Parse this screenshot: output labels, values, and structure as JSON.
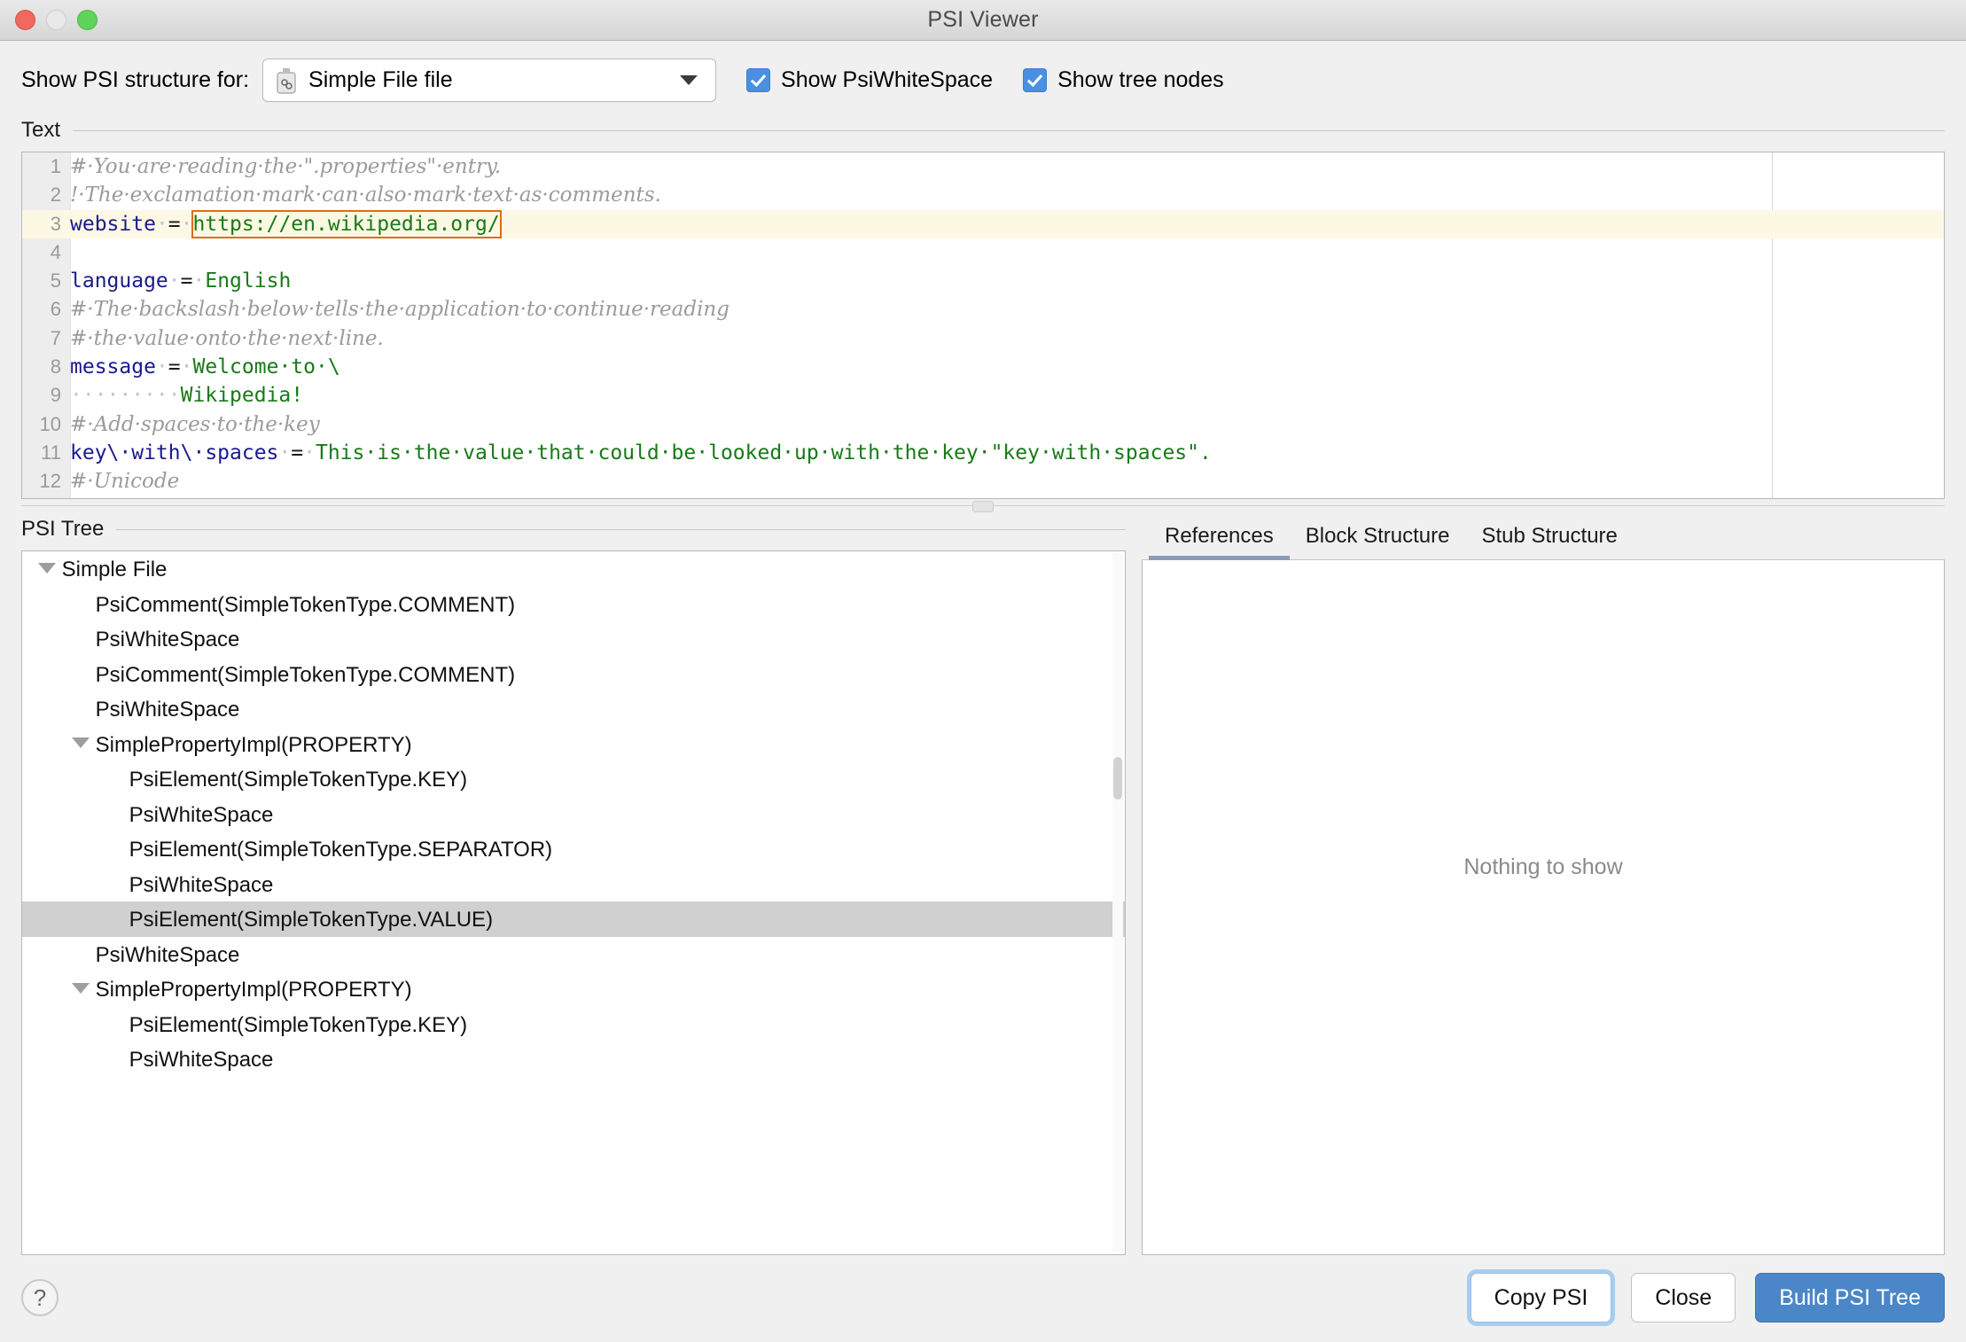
{
  "window": {
    "title": "PSI Viewer",
    "traffic_lights": [
      "close-red",
      "minimize-gray",
      "zoom-green"
    ]
  },
  "toolbar": {
    "label": "Show PSI structure for:",
    "combo": {
      "icon": "properties-file-icon",
      "value": "Simple File file",
      "caret": "chevron-down-icon"
    },
    "checkboxes": [
      {
        "label": "Show PsiWhiteSpace",
        "checked": true
      },
      {
        "label": "Show tree nodes",
        "checked": true
      }
    ]
  },
  "text_group": {
    "title": "Text",
    "lines": [
      {
        "n": "1",
        "highlight": false,
        "tokens": [
          {
            "t": "comment",
            "s": "#·You·are·reading·the·\".properties\"·entry."
          }
        ]
      },
      {
        "n": "2",
        "highlight": false,
        "tokens": [
          {
            "t": "comment",
            "s": "!·The·exclamation·mark·can·also·mark·text·as·comments."
          }
        ]
      },
      {
        "n": "3",
        "highlight": true,
        "tokens": [
          {
            "t": "key",
            "s": "website"
          },
          {
            "t": "ws",
            "s": "·"
          },
          {
            "t": "eq",
            "s": "="
          },
          {
            "t": "ws",
            "s": "·"
          },
          {
            "t": "val-selected",
            "s": "https://en.wikipedia.org/"
          }
        ]
      },
      {
        "n": "4",
        "highlight": false,
        "tokens": []
      },
      {
        "n": "5",
        "highlight": false,
        "tokens": [
          {
            "t": "key",
            "s": "language"
          },
          {
            "t": "ws",
            "s": "·"
          },
          {
            "t": "eq",
            "s": "="
          },
          {
            "t": "ws",
            "s": "·"
          },
          {
            "t": "val",
            "s": "English"
          }
        ]
      },
      {
        "n": "6",
        "highlight": false,
        "tokens": [
          {
            "t": "comment",
            "s": "#·The·backslash·below·tells·the·application·to·continue·reading"
          }
        ]
      },
      {
        "n": "7",
        "highlight": false,
        "tokens": [
          {
            "t": "comment",
            "s": "#·the·value·onto·the·next·line."
          }
        ]
      },
      {
        "n": "8",
        "highlight": false,
        "tokens": [
          {
            "t": "key",
            "s": "message"
          },
          {
            "t": "ws",
            "s": "·"
          },
          {
            "t": "eq",
            "s": "="
          },
          {
            "t": "ws",
            "s": "·"
          },
          {
            "t": "val",
            "s": "Welcome·to·\\"
          }
        ]
      },
      {
        "n": "9",
        "highlight": false,
        "tokens": [
          {
            "t": "ws",
            "s": "·········"
          },
          {
            "t": "val",
            "s": "Wikipedia!"
          }
        ]
      },
      {
        "n": "10",
        "highlight": false,
        "tokens": [
          {
            "t": "comment",
            "s": "#·Add·spaces·to·the·key"
          }
        ]
      },
      {
        "n": "11",
        "highlight": false,
        "tokens": [
          {
            "t": "key",
            "s": "key\\·with\\·spaces"
          },
          {
            "t": "ws",
            "s": "·"
          },
          {
            "t": "eq",
            "s": "="
          },
          {
            "t": "ws",
            "s": "·"
          },
          {
            "t": "val",
            "s": "This·is·the·value·that·could·be·looked·up·with·the·key·\"key·with·spaces\"."
          }
        ]
      },
      {
        "n": "12",
        "highlight": false,
        "tokens": [
          {
            "t": "comment",
            "s": "#·Unicode"
          }
        ]
      }
    ]
  },
  "psi_tree": {
    "title": "PSI Tree",
    "rows": [
      {
        "label": "Simple File",
        "indent": 0,
        "twisty": true,
        "selected": false
      },
      {
        "label": "PsiComment(SimpleTokenType.COMMENT)",
        "indent": 1,
        "twisty": false,
        "selected": false
      },
      {
        "label": "PsiWhiteSpace",
        "indent": 1,
        "twisty": false,
        "selected": false
      },
      {
        "label": "PsiComment(SimpleTokenType.COMMENT)",
        "indent": 1,
        "twisty": false,
        "selected": false
      },
      {
        "label": "PsiWhiteSpace",
        "indent": 1,
        "twisty": false,
        "selected": false
      },
      {
        "label": "SimplePropertyImpl(PROPERTY)",
        "indent": 1,
        "twisty": true,
        "selected": false
      },
      {
        "label": "PsiElement(SimpleTokenType.KEY)",
        "indent": 2,
        "twisty": false,
        "selected": false
      },
      {
        "label": "PsiWhiteSpace",
        "indent": 2,
        "twisty": false,
        "selected": false
      },
      {
        "label": "PsiElement(SimpleTokenType.SEPARATOR)",
        "indent": 2,
        "twisty": false,
        "selected": false
      },
      {
        "label": "PsiWhiteSpace",
        "indent": 2,
        "twisty": false,
        "selected": false
      },
      {
        "label": "PsiElement(SimpleTokenType.VALUE)",
        "indent": 2,
        "twisty": false,
        "selected": true
      },
      {
        "label": "PsiWhiteSpace",
        "indent": 1,
        "twisty": false,
        "selected": false
      },
      {
        "label": "SimplePropertyImpl(PROPERTY)",
        "indent": 1,
        "twisty": true,
        "selected": false
      },
      {
        "label": "PsiElement(SimpleTokenType.KEY)",
        "indent": 2,
        "twisty": false,
        "selected": false
      },
      {
        "label": "PsiWhiteSpace",
        "indent": 2,
        "twisty": false,
        "selected": false
      }
    ]
  },
  "right_panel": {
    "tabs": [
      {
        "label": "References",
        "active": true
      },
      {
        "label": "Block Structure",
        "active": false
      },
      {
        "label": "Stub Structure",
        "active": false
      }
    ],
    "empty_text": "Nothing to show"
  },
  "footer": {
    "help": "?",
    "buttons": [
      {
        "label": "Copy PSI",
        "style": "focused"
      },
      {
        "label": "Close",
        "style": "default"
      },
      {
        "label": "Build PSI Tree",
        "style": "primary"
      }
    ]
  },
  "colors": {
    "accent": "#4a86c8",
    "selection_box": "#e06c10",
    "highlight_line": "#fdf8e3",
    "checkbox": "#4a90e2",
    "tab_underline": "#8a9bb5",
    "tree_selected": "#d0d0d0"
  }
}
